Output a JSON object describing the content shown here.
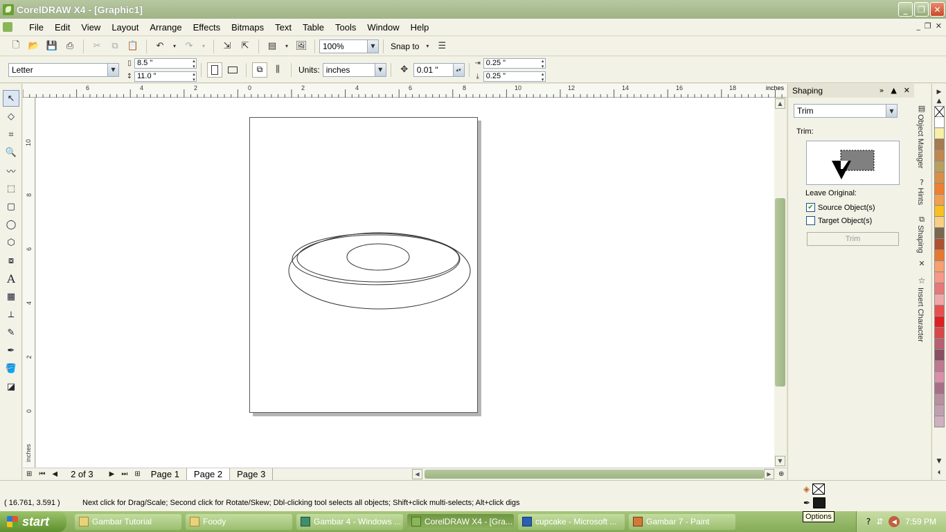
{
  "window": {
    "title": "CorelDRAW X4 - [Graphic1]",
    "min": "_",
    "max": "❐",
    "close": "✕"
  },
  "menu": [
    "File",
    "Edit",
    "View",
    "Layout",
    "Arrange",
    "Effects",
    "Bitmaps",
    "Text",
    "Table",
    "Tools",
    "Window",
    "Help"
  ],
  "toolbar": {
    "zoom": "100%",
    "snap_to": "Snap to"
  },
  "propbar": {
    "paper": "Letter",
    "width": "8.5 \"",
    "height": "11.0 \"",
    "units_label": "Units:",
    "units": "inches",
    "nudge": "0.01 \"",
    "dup_x": "0.25 \"",
    "dup_y": "0.25 \""
  },
  "ruler": {
    "h_labels": [
      "6",
      "4",
      "2",
      "0",
      "2",
      "4",
      "6",
      "8",
      "10",
      "12",
      "14",
      "16",
      "18"
    ],
    "v_labels": [
      "10",
      "8",
      "6",
      "4",
      "2",
      "0"
    ],
    "units": "inches"
  },
  "pagenav": {
    "count": "2 of 3",
    "pages": [
      "Page 1",
      "Page 2",
      "Page 3"
    ],
    "active": 1
  },
  "docker": {
    "title": "Shaping",
    "operation": "Trim",
    "trim_label": "Trim:",
    "leave_original": "Leave Original:",
    "source": {
      "label": "Source Object(s)",
      "checked": true
    },
    "target": {
      "label": "Target Object(s)",
      "checked": false
    },
    "apply": "Trim"
  },
  "side_tabs": [
    "Object Manager",
    "Hints",
    "Shaping",
    "Insert Character"
  ],
  "palette": [
    "#ffffff",
    "#f7f0a8",
    "#a67b50",
    "#c08850",
    "#b8a060",
    "#d89048",
    "#f08030",
    "#f0a050",
    "#f8c020",
    "#f8d080",
    "#786850",
    "#b05030",
    "#e87830",
    "#f8a070",
    "#f89888",
    "#e87878",
    "#f0a8a8",
    "#e85050",
    "#e02020",
    "#d84848",
    "#b86070",
    "#885060",
    "#c07890",
    "#d890a8",
    "#a87088",
    "#b890a0",
    "#c0a0b0",
    "#d0b0c0"
  ],
  "status": {
    "coords": "( 16.761, 3.591 )",
    "message": "Next click for Drag/Scale; Second click for Rotate/Skew; Dbl-clicking tool selects all objects; Shift+click multi-selects; Alt+click digs",
    "tooltip": "Options"
  },
  "taskbar": {
    "start": "start",
    "tasks": [
      "Gambar Tutorial",
      "Foody",
      "Gambar 4 - Windows ...",
      "CorelDRAW X4 - [Gra...",
      "cupcake - Microsoft ...",
      "Gambar 7 - Paint"
    ],
    "active": 3,
    "clock": "7:59 PM"
  }
}
